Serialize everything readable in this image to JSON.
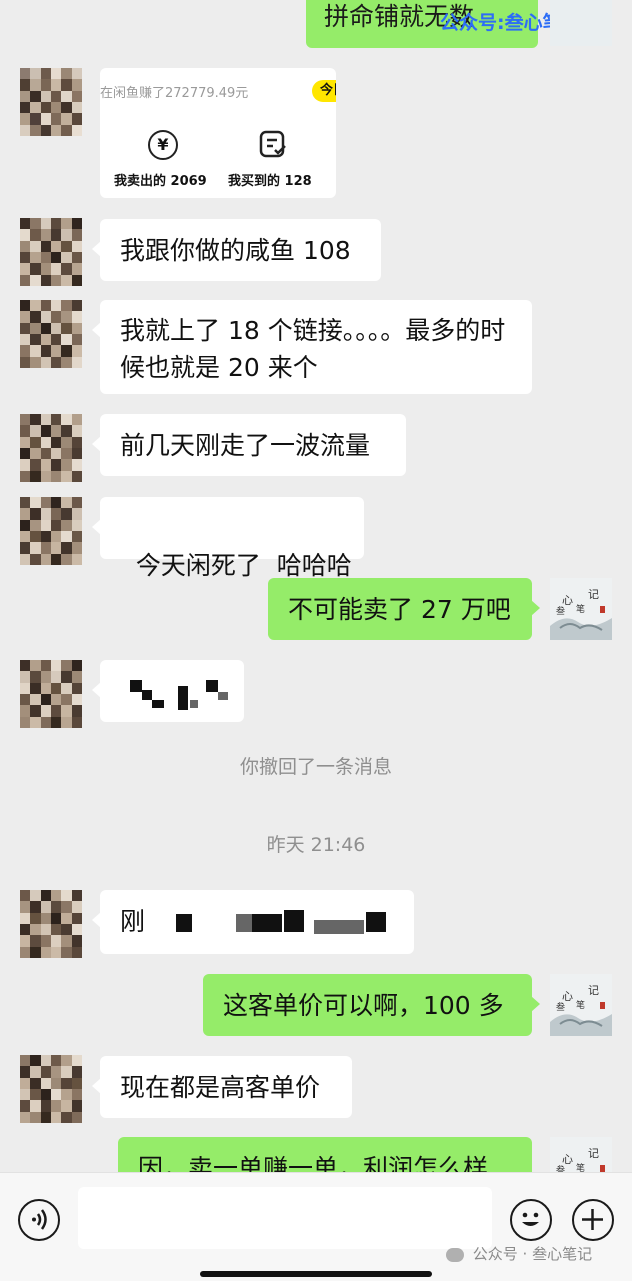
{
  "watermark_top": "公众号:叁心笔记",
  "card": {
    "earned_text": "在闲鱼赚了272779.49元",
    "badge": "今日",
    "sold_label": "我卖出的",
    "sold_count": "2069",
    "bought_label": "我买到的",
    "bought_count": "128"
  },
  "messages": [
    {
      "side": "left",
      "text": "我跟你做的咸鱼 108"
    },
    {
      "side": "left",
      "line1": "我就上了 18 个链接。。。。最多的时",
      "line2": "候也就是 20 来个"
    },
    {
      "side": "left",
      "text": "前几天刚走了一波流量"
    },
    {
      "side": "left",
      "text": "今天闲死了  哈哈哈"
    },
    {
      "side": "right",
      "text": "不可能卖了 27 万吧"
    },
    {
      "side": "left",
      "text": ""
    },
    {
      "side": "left",
      "text": "刚"
    },
    {
      "side": "right",
      "text": "这客单价可以啊，100 多"
    },
    {
      "side": "left",
      "text": "现在都是高客单价"
    },
    {
      "side": "right",
      "text": "因，卖一单赚一单，利润怎么样"
    }
  ],
  "system": {
    "recalled": "你撤回了一条消息",
    "timestamp": "昨天 21:46"
  },
  "top_partial_text": "拼命铺就无数",
  "input": {
    "value": ""
  },
  "watermark_bottom": "公众号 · 叁心笔记",
  "icons": {
    "voice": "voice-icon",
    "emoji": "emoji-icon",
    "plus": "plus-icon"
  }
}
